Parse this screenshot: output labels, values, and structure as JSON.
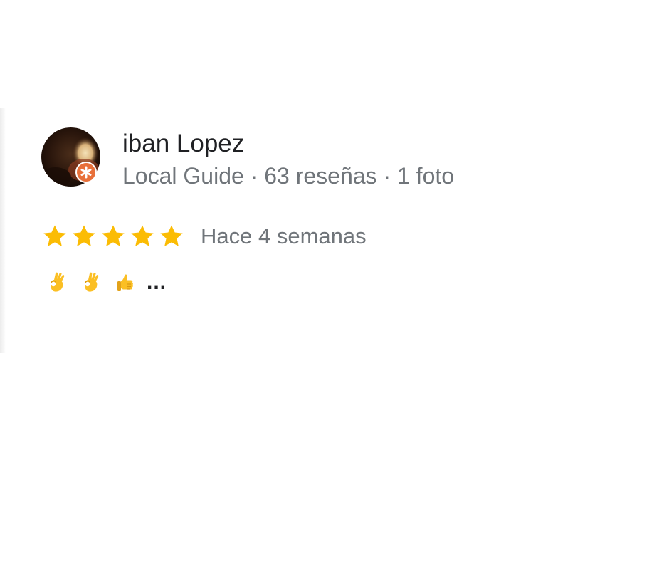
{
  "review": {
    "author": {
      "name": "iban Lopez",
      "meta": "Local Guide · 63 reseñas · 1 foto",
      "avatar_icon": "avatar-photo",
      "badge_icon": "local-guide-badge-icon",
      "badge_color": "#e8703a"
    },
    "rating": {
      "stars": 5,
      "max_stars": 5,
      "star_color": "#fbbc04",
      "date": "Hace 4 semanas"
    },
    "text": {
      "emojis": [
        "ok-hand-emoji",
        "ok-hand-emoji",
        "thumbs-up-emoji"
      ],
      "ellipsis": "..."
    }
  }
}
